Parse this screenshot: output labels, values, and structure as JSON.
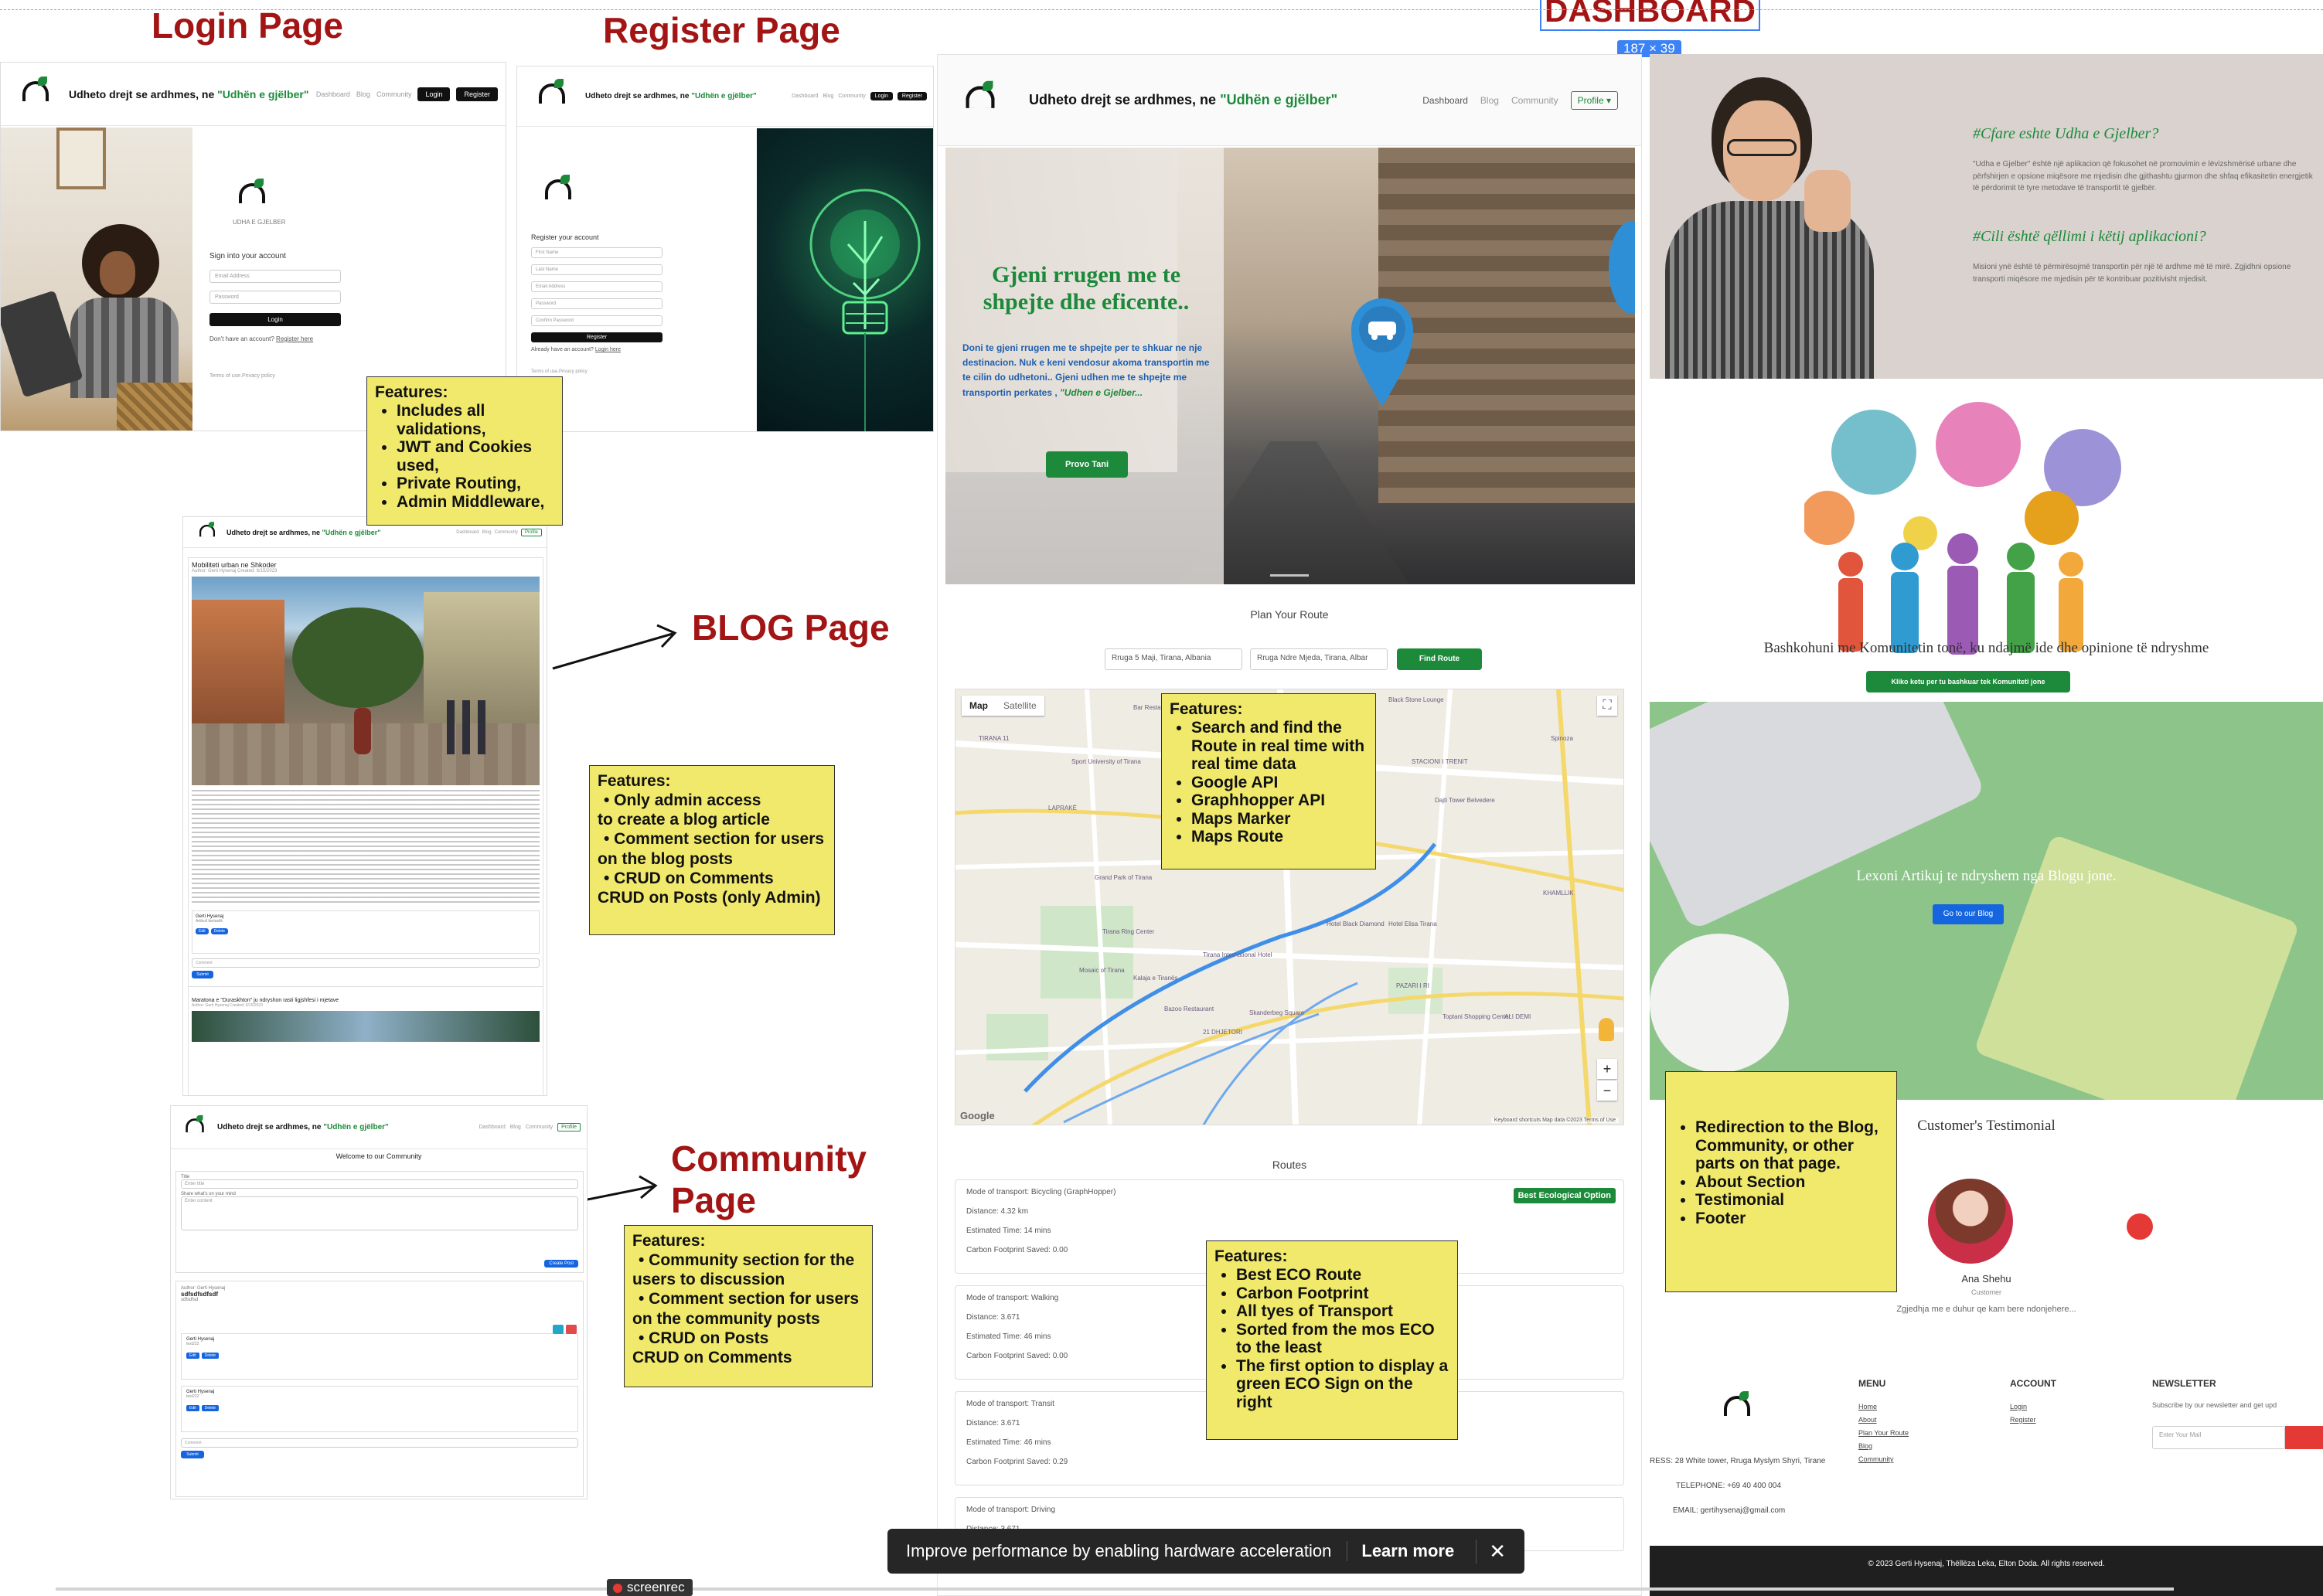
{
  "headings": {
    "login": "Login Page",
    "register": "Register Page",
    "dashboard": "DASHBOARD",
    "blog": "BLOG Page",
    "community": "Community Page"
  },
  "selection_badge": "187 × 39",
  "brand": {
    "prefix": "Udheto drejt se ardhmes, ne ",
    "highlight": "\"Udhën e gjëlber\""
  },
  "logo": {
    "text": "UDHA E GJELBER"
  },
  "nav": {
    "dashboard": "Dashboard",
    "blog": "Blog",
    "community": "Community",
    "login": "Login",
    "register": "Register",
    "profile": "Profile"
  },
  "login_page": {
    "title": "Sign into your account",
    "email_placeholder": "Email Address",
    "password_placeholder": "Password",
    "button": "Login",
    "no_account": "Don't have an account?",
    "register_link": "Register here",
    "terms": "Terms of use.Privacy policy"
  },
  "register_page": {
    "title": "Register your account",
    "fields": [
      "First Name",
      "Last Name",
      "Email Address",
      "Password",
      "Confirm Password"
    ],
    "button": "Register",
    "have_account": "Already have an account?",
    "login_link": "Login here",
    "terms": "Terms of use.Privacy policy"
  },
  "notes": {
    "auth": {
      "title": "Features:",
      "items": [
        "Includes all validations,",
        "JWT and Cookies used,",
        "Private Routing,",
        "Admin Middleware,"
      ]
    },
    "blog": {
      "title": "Features:",
      "lines": [
        "Only admin access",
        "to create a blog article",
        "Comment section for users",
        "on the blog posts",
        "CRUD on Comments",
        "CRUD on Posts (only Admin)"
      ]
    },
    "community": {
      "title": "Features:",
      "lines": [
        "Community section for the",
        "users to discussion",
        "Comment section for users",
        "on the community posts",
        "CRUD on Posts",
        "CRUD on Comments"
      ]
    },
    "map": {
      "title": "Features:",
      "items": [
        "Search and find the Route in real time with real time data",
        "Google API",
        "Graphhopper API",
        "Maps Marker",
        "Maps Route"
      ]
    },
    "routes": {
      "title": "Features:",
      "items": [
        "Best ECO Route",
        "Carbon Footprint",
        "All tyes of Transport",
        "Sorted from the mos ECO to the least",
        "The first option to display a green ECO Sign on the right"
      ]
    },
    "home": {
      "items": [
        "Redirection to the Blog, Community, or other parts on that page.",
        "About Section",
        "Testimonial",
        "Footer"
      ]
    }
  },
  "blog_page": {
    "post_title": "Mobiliteti urban ne Shkoder",
    "post_meta": "Author: Gerti Hysenaj Created: 6/15/2023",
    "comment_author": "Gerti Hysenaj",
    "comment_text": "Artikull fantastik",
    "edit": "Edit",
    "delete": "Delete",
    "comment_placeholder": "Comment",
    "submit": "Submit",
    "next_post_title": "Maratona e \"Duraskhton\" ju ndryshon rasti ligjshfesi i mjetave",
    "next_post_meta": "Author: Gerti Hysenaj Created: 6/15/2023"
  },
  "community_page": {
    "welcome": "Welcome to our Community",
    "title_label": "Title",
    "title_placeholder": "Enter title",
    "share_label": "Share what's on your mind",
    "content_placeholder": "Enter content",
    "create_button": "Create Post",
    "post_author": "Author: Gerti Hysenaj",
    "post_title": "sdfsdfsdfsdf",
    "post_body": "sdfsdfsd",
    "comments": [
      {
        "author": "Gerti Hysenaj",
        "text": "test222"
      },
      {
        "author": "Gerti Hysenaj",
        "text": "test222"
      }
    ],
    "edit": "Edit",
    "delete": "Delete",
    "comment_placeholder": "Comment",
    "submit": "Submit"
  },
  "dashboard_page": {
    "hero_title": "Gjeni rrugen me te shpejte dhe eficente..",
    "hero_text": "Doni te gjeni rrugen me te shpejte per te shkuar ne nje destinacion. Nuk e keni vendosur akoma transportin me te cilin do udhetoni.. Gjeni udhen me te shpejte me transportin perkates , ",
    "hero_text_highlight": "\"Udhen e Gjelber...",
    "hero_button": "Provo Tani",
    "plan_title": "Plan Your Route",
    "from_value": "Rruga 5 Maji, Tirana, Albania",
    "to_value": "Rruga Ndre Mjeda, Tirana, Albar",
    "find_button": "Find Route",
    "map_tab_map": "Map",
    "map_tab_satellite": "Satellite",
    "map_labels": [
      "TIRANA 11",
      "LAPRAKË",
      "Bar Restaurant Lapraja Tirane",
      "Sport University of Tirana",
      "Grand Park of Tirana",
      "Tirana Ring Center",
      "Kalaja e Tiranës",
      "Hotel Elisa Tirana",
      "Tirana International Hotel",
      "Black Stone Lounge",
      "Spinoza",
      "PAZARI I RI",
      "21 DHJETORI",
      "ALI DEMI",
      "STACIONI I TRENIT",
      "KHAMLLIK",
      "Skanderbeg Square",
      "Mosaic of Tirana",
      "Bazoo Restaurant",
      "Hotel Black Diamond",
      "Toptani Shopping Center",
      "Dajti Tower Belvedere"
    ],
    "map_attribution": "Keyboard shortcuts   Map data ©2023   Terms of Use",
    "routes_title": "Routes",
    "routes": [
      {
        "mode": "Mode of transport: Bicycling (GraphHopper)",
        "distance": "Distance: 4.32 km",
        "time": "Estimated Time: 14 mins",
        "carbon": "Carbon Footprint Saved: 0.00",
        "badge": "Best Ecological Option"
      },
      {
        "mode": "Mode of transport: Walking",
        "distance": "Distance: 3.671",
        "time": "Estimated Time: 46 mins",
        "carbon": "Carbon Footprint Saved: 0.00",
        "badge": ""
      },
      {
        "mode": "Mode of transport: Transit",
        "distance": "Distance: 3.671",
        "time": "Estimated Time: 46 mins",
        "carbon": "Carbon Footprint Saved: 0.29",
        "badge": ""
      },
      {
        "mode": "Mode of transport: Driving",
        "distance": "Distance: 3.671",
        "time": "",
        "carbon": "",
        "badge": ""
      }
    ]
  },
  "home_page": {
    "about_q1": "#Cfare eshte Udha e Gjelber?",
    "about_a1": "\"Udha e Gjelber\" është një aplikacion që fokusohet në promovimin e lëvizshmërisë urbane dhe përfshirjen e opsione miqësore me mjedisin dhe gjithashtu gjurmon dhe shfaq efikasitetin energjetik të përdorimit të tyre metodave të transportit të gjelbër.",
    "about_q2": "#Cili është qëllimi i këtij aplikacioni?",
    "about_a2": "Misioni ynë është të përmirësojmë transportin për një të ardhme më të mirë. Zgjidhni opsione transporti miqësore me mjedisin për të kontribuar pozitivisht mjedisit.",
    "community_text": "Bashkohuni me Komunitetin tonë, ku ndajmë ide dhe opinione të ndryshme",
    "community_button": "Kliko ketu per tu bashkuar tek Komuniteti jone",
    "blog_text": "Lexoni Artikuj te ndryshem nga Blogu jone.",
    "blog_button": "Go to our Blog",
    "testimonial_title": "Customer's Testimonial",
    "testimonial_name": "Ana Shehu",
    "testimonial_role": "Customer",
    "testimonial_quote": "Zgjedhja me e duhur qe kam bere ndonjehere...",
    "footer_menu_title": "MENU",
    "footer_menu": [
      "Home",
      "About",
      "Plan Your Route",
      "Blog",
      "Community"
    ],
    "footer_account_title": "ACCOUNT",
    "footer_account": [
      "Login",
      "Register"
    ],
    "footer_newsletter_title": "NEWSLETTER",
    "footer_newsletter_text": "Subscribe by our newsletter and get upd",
    "footer_newsletter_placeholder": "Enter Your Mail",
    "footer_address": "RESS: 28 White tower, Rruga Myslym Shyri, Tirane",
    "footer_phone": "TELEPHONE: +69 40 400 004",
    "footer_email": "EMAIL: gertihysenaj@gmail.com",
    "copyright": "© 2023 Gerti Hysenaj, Thëllëza Leka, Elton Doda. All rights reserved."
  },
  "toast": {
    "text": "Improve performance by enabling hardware acceleration",
    "learn_more": "Learn more"
  },
  "watermark": "screenrec",
  "colors": {
    "green": "#1c8a3a",
    "note_yellow": "#f0e96c",
    "heading_red": "#a31515",
    "blue": "#1565e0",
    "record_red": "#e53935"
  }
}
